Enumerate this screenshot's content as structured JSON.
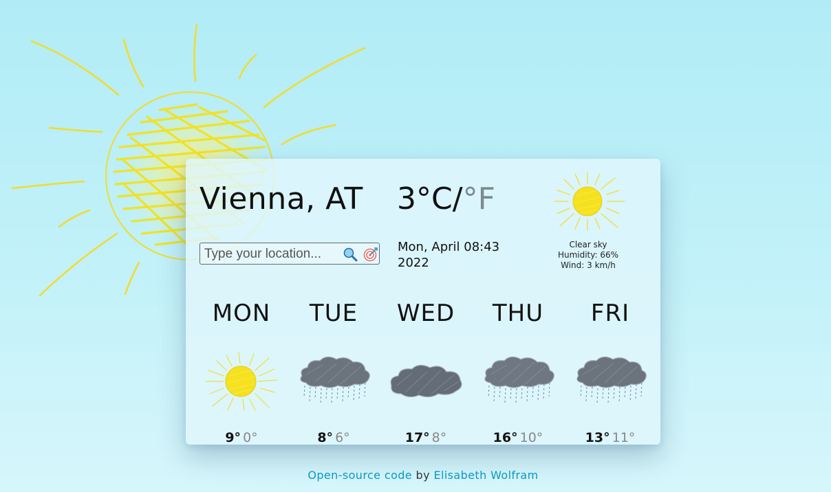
{
  "location": {
    "city": "Vienna, AT"
  },
  "current": {
    "temp": "3",
    "unit_c": "°C",
    "separator": "/",
    "unit_f": "°F",
    "datetime_line1": "Mon, April 08:43",
    "datetime_line2": "2022",
    "condition": "Clear sky",
    "humidity": "Humidity: 66%",
    "wind": "Wind: 3 km/h",
    "icon": "sun-icon"
  },
  "search": {
    "placeholder": "Type your location...",
    "search_icon": "search-icon",
    "locate_icon": "target-icon"
  },
  "forecast": [
    {
      "day": "MON",
      "high": "9°",
      "low": "0°",
      "icon": "sun-icon"
    },
    {
      "day": "TUE",
      "high": "8°",
      "low": "6°",
      "icon": "rain-cloud-icon"
    },
    {
      "day": "WED",
      "high": "17°",
      "low": "8°",
      "icon": "cloud-icon"
    },
    {
      "day": "THU",
      "high": "16°",
      "low": "10°",
      "icon": "rain-cloud-icon"
    },
    {
      "day": "FRI",
      "high": "13°",
      "low": "11°",
      "icon": "rain-cloud-icon"
    }
  ],
  "footer": {
    "code_link": "Open-source code",
    "by": " by ",
    "author_link": "Elisabeth Wolfram"
  },
  "colors": {
    "background": "#b1ecf6",
    "sun": "#f5e11a",
    "link": "#0b97c6",
    "muted_unit": "#7c8a8e"
  }
}
